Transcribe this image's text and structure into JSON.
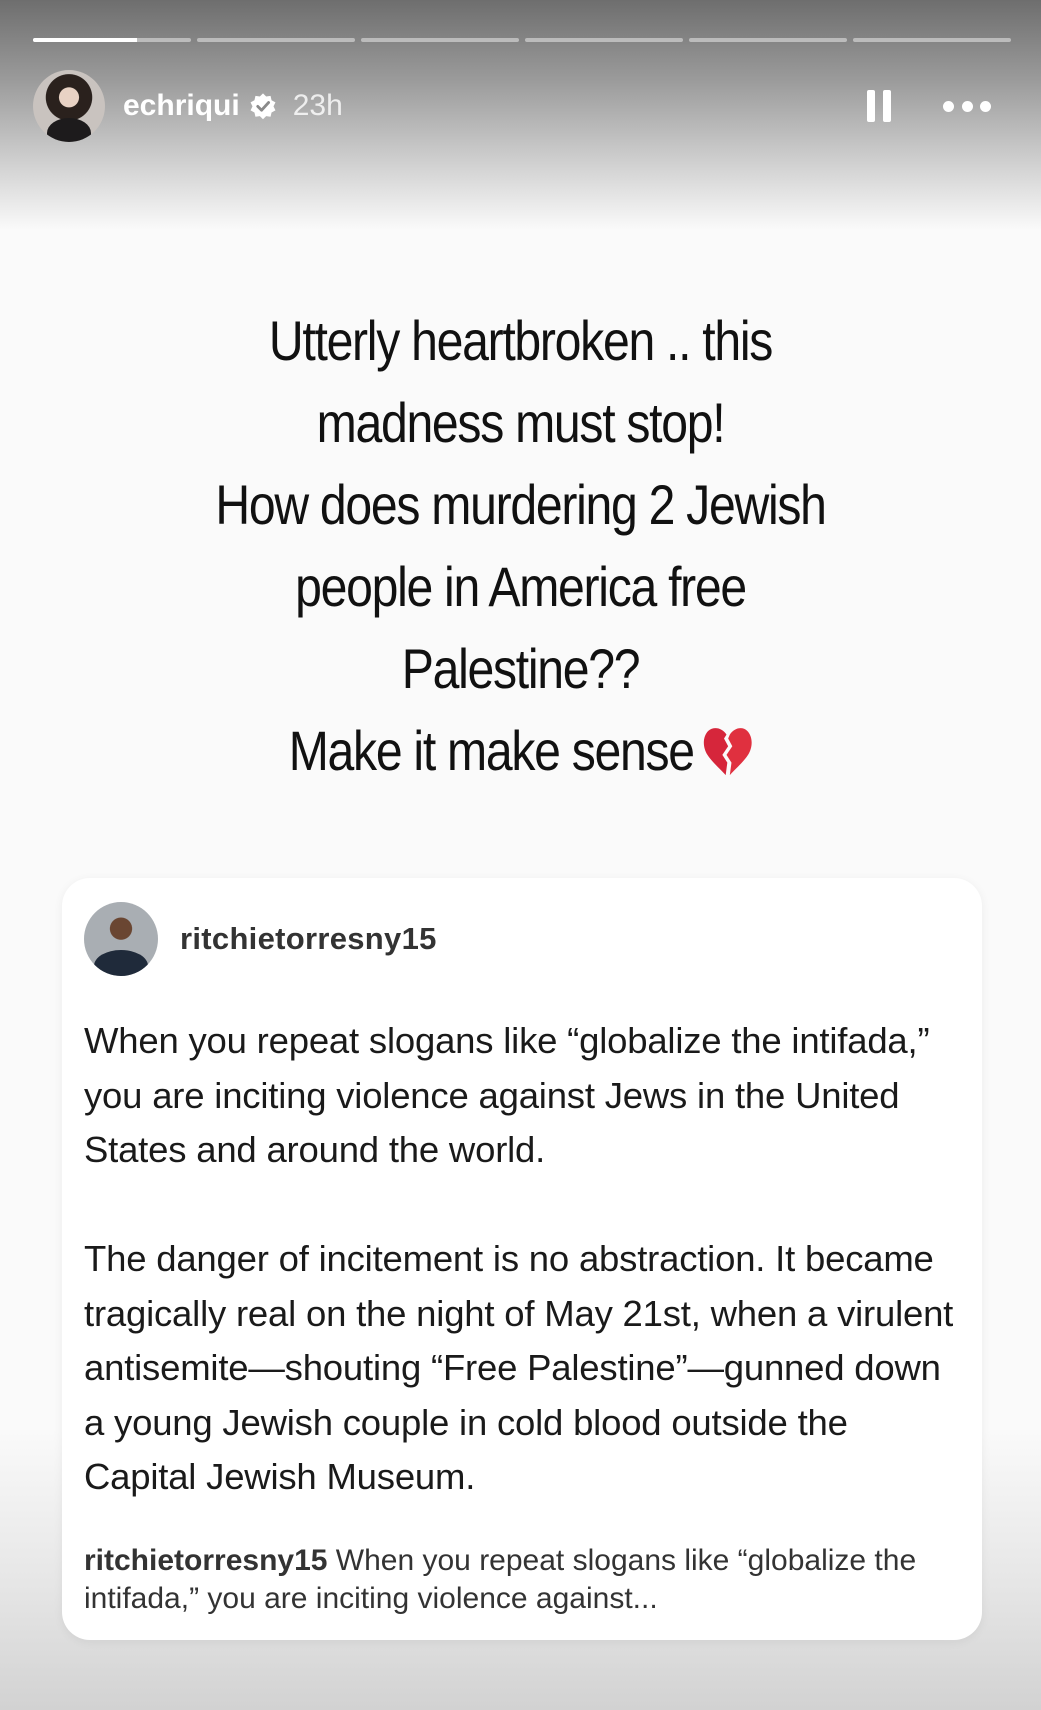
{
  "story": {
    "progress": {
      "segments": 6,
      "active_index": 0,
      "active_fraction": 0.66
    },
    "header": {
      "username": "echriqui",
      "verified": true,
      "time_ago": "23h"
    },
    "caption": {
      "lines": [
        "Utterly heartbroken .. this",
        "madness must stop!",
        "How does murdering  2 Jewish",
        "people in America free",
        "Palestine??",
        "Make it make sense"
      ],
      "emoji": "broken-heart-icon"
    },
    "shared_post": {
      "username": "ritchietorresny15",
      "paragraphs": [
        "When you repeat slogans like “globalize the intifada,” you are inciting violence against Jews in the United States and around the world.",
        "The danger of incitement is no abstraction. It became tragically real on the night of May 21st, when a virulent antisemite—shouting “Free Palestine”—gunned down a young Jewish couple in cold blood outside the Capital Jewish Museum."
      ],
      "footer_username": "ritchietorresny15",
      "footer_text": " When you repeat slogans like “globalize the intifada,” you are inciting violence against..."
    },
    "colors": {
      "text": "#111111",
      "header_text": "#ffffff",
      "card_bg": "#ffffff",
      "heart": "#d6263b"
    }
  }
}
